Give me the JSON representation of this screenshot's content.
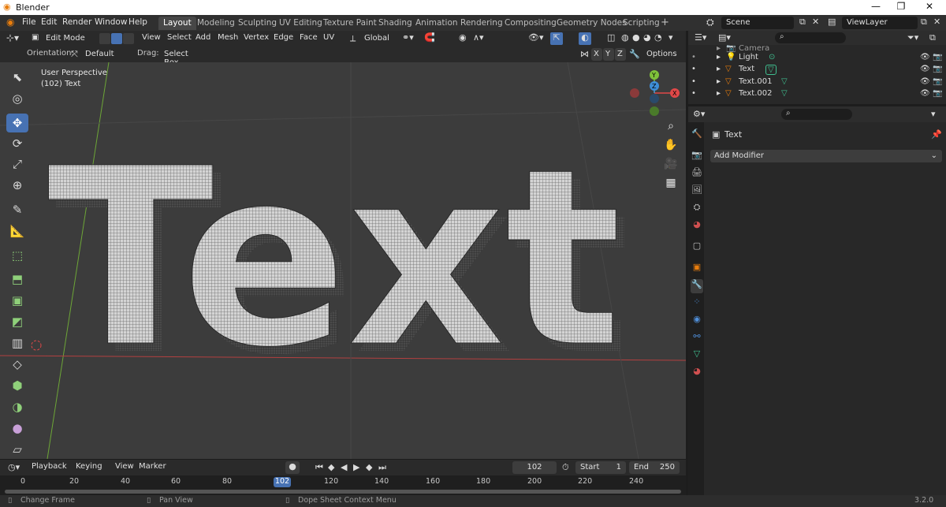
{
  "window": {
    "title": "Blender",
    "controls": [
      "—",
      "❐",
      "✕"
    ]
  },
  "menus": [
    "File",
    "Edit",
    "Render",
    "Window",
    "Help"
  ],
  "workspaces": [
    {
      "label": "Layout",
      "active": true
    },
    {
      "label": "Modeling"
    },
    {
      "label": "Sculpting"
    },
    {
      "label": "UV Editing"
    },
    {
      "label": "Texture Paint"
    },
    {
      "label": "Shading"
    },
    {
      "label": "Animation"
    },
    {
      "label": "Rendering"
    },
    {
      "label": "Compositing"
    },
    {
      "label": "Geometry Nodes"
    },
    {
      "label": "Scripting"
    }
  ],
  "add_workspace": "+",
  "scene": {
    "label": "Scene",
    "view_layer": "ViewLayer"
  },
  "header3d": {
    "mode": "Edit Mode",
    "menus": [
      "View",
      "Select",
      "Add",
      "Mesh",
      "Vertex",
      "Edge",
      "Face",
      "UV"
    ],
    "transform": "Global"
  },
  "header2": {
    "orientation_label": "Orientation:",
    "orientation_value": "Default",
    "drag_label": "Drag:",
    "drag_value": "Select Box",
    "axes": [
      "X",
      "Y",
      "Z"
    ],
    "options": "Options"
  },
  "viewport": {
    "perspective": "User Perspective",
    "object": "(102) Text",
    "text3d": "Text"
  },
  "gizmo": {
    "x": "X",
    "y": "Y",
    "z": "Z"
  },
  "outliner": {
    "rows": [
      {
        "label": "Camera",
        "icon": "camera-icon"
      },
      {
        "label": "Light",
        "icon": "light-icon"
      },
      {
        "label": "Text",
        "icon": "text-object-icon"
      },
      {
        "label": "Text.001",
        "icon": "text-object-icon"
      },
      {
        "label": "Text.002",
        "icon": "text-object-icon"
      }
    ]
  },
  "properties": {
    "object_name": "Text",
    "add_modifier": "Add Modifier"
  },
  "timeline": {
    "menus": [
      "Playback",
      "Keying",
      "View",
      "Marker"
    ],
    "current_frame": "102",
    "start_label": "Start",
    "start": "1",
    "end_label": "End",
    "end": "250"
  },
  "ruler": {
    "ticks": [
      "0",
      "20",
      "40",
      "60",
      "80",
      "100",
      "120",
      "140",
      "160",
      "180",
      "200",
      "220",
      "240"
    ],
    "current": "102"
  },
  "status": {
    "items": [
      "Change Frame",
      "Pan View",
      "Dope Sheet Context Menu"
    ],
    "version": "3.2.0"
  },
  "colors": {
    "accent": "#4772b3",
    "axis_x": "#e04848",
    "axis_y": "#7fc13a",
    "axis_z": "#3e8ed8",
    "text_mesh": "#cfcfcf"
  }
}
